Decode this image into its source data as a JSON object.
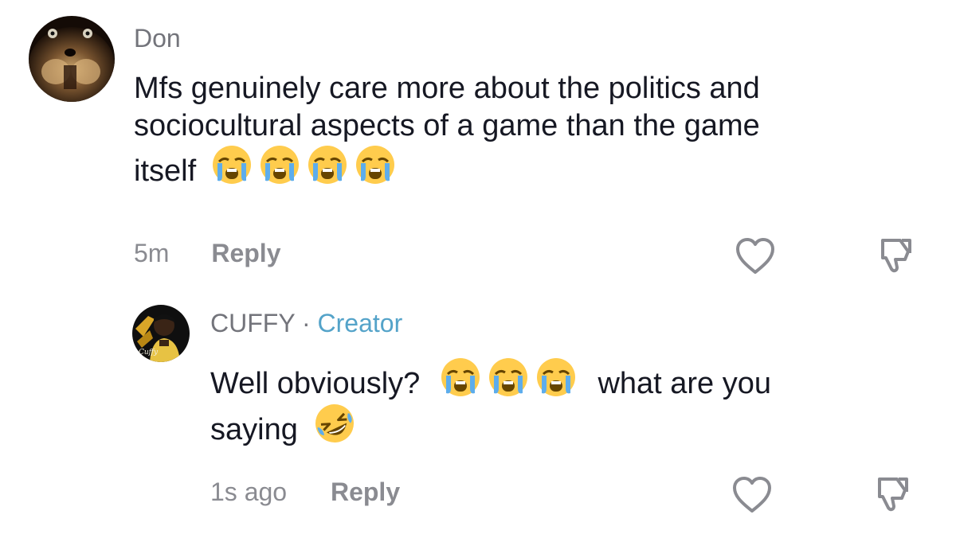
{
  "comments": [
    {
      "username": "Don",
      "text_parts": [
        "Mfs genuinely care more about the politics and",
        "sociocultural aspects of a game than the game",
        "itself"
      ],
      "emoji_trailing": [
        "crying-face-emoji",
        "crying-face-emoji",
        "crying-face-emoji",
        "crying-face-emoji"
      ],
      "time": "5m",
      "reply_label": "Reply",
      "like_icon": "heart-outline-icon",
      "dislike_icon": "thumbs-down-icon"
    }
  ],
  "reply": {
    "username": "CUFFY",
    "separator": "·",
    "creator_badge": "Creator",
    "avatar_label": "Cuffy",
    "text_before_emoji": "Well obviously?",
    "text_after_emoji": "what are you",
    "text_line2": "saying",
    "emoji_inline": [
      "crying-face-emoji",
      "crying-face-emoji",
      "crying-face-emoji"
    ],
    "emoji_trailing": [
      "rofl-emoji"
    ],
    "time": "1s ago",
    "reply_label": "Reply",
    "like_icon": "heart-outline-icon",
    "dislike_icon": "thumbs-down-icon"
  },
  "colors": {
    "username": "#73747b",
    "creator": "#54a3c9",
    "text": "#161823",
    "meta": "#8a8b91"
  }
}
